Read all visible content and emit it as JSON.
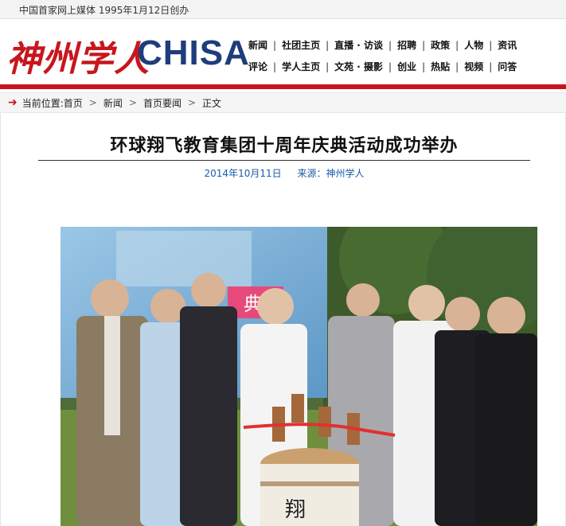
{
  "topbar": {
    "tagline": "中国首家网上媒体  1995年1月12日创办"
  },
  "logo": {
    "cn": "神州学人",
    "en": "CHISA"
  },
  "nav": {
    "row1": [
      "新闻",
      "社团主页",
      "直播 · 访谈",
      "招聘",
      "政策",
      "人物",
      "资讯"
    ],
    "row2": [
      "评论",
      "学人主页",
      "文苑 · 摄影",
      "创业",
      "热贴",
      "视频",
      "问答"
    ]
  },
  "breadcrumb": {
    "label": "当前位置:",
    "items": [
      "首页",
      "新闻",
      "首页要闻",
      "正文"
    ]
  },
  "article": {
    "title": "环球翔飞教育集团十周年庆典活动成功举办",
    "date": "2014年10月11日",
    "source": "来源：神州学人"
  },
  "photo": {
    "banner_text": "典",
    "barrel_text": "翔"
  },
  "colors": {
    "brand_red": "#c8161d",
    "brand_blue": "#1f3d7a",
    "meta_blue": "#1a5aa8"
  }
}
